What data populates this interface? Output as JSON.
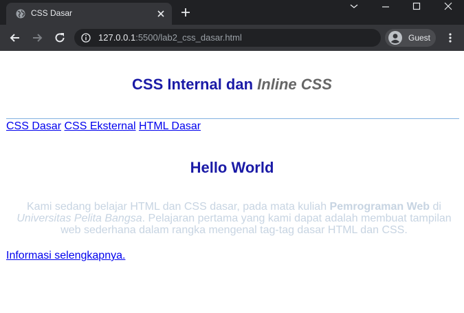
{
  "browser": {
    "tab_title": "CSS Dasar",
    "url_host": "127.0.0.1",
    "url_rest": ":5500/lab2_css_dasar.html",
    "profile_label": "Guest"
  },
  "page": {
    "heading_part1": "CSS Internal dan ",
    "heading_italic": "Inline CSS",
    "nav_links": [
      "CSS Dasar",
      "CSS Eksternal",
      "HTML Dasar"
    ],
    "hello": "Hello World",
    "paragraph": {
      "t1": "Kami sedang belajar HTML dan CSS dasar, pada mata kuliah ",
      "bold": "Pemrograman Web",
      "t2": " di ",
      "italic": "Universitas Pelita Bangsa",
      "t3": ". Pelajaran pertama yang kami dapat adalah membuat tampilan web sederhana dalam rangka mengenal tag-tag dasar HTML dan CSS."
    },
    "more_link": "Informasi selengkapnya."
  },
  "colors": {
    "heading": "#1a1aa6",
    "heading_italic": "#666666",
    "link": "#0000ee",
    "paragraph": "#c7d4e2",
    "rule": "#80b0e0"
  }
}
